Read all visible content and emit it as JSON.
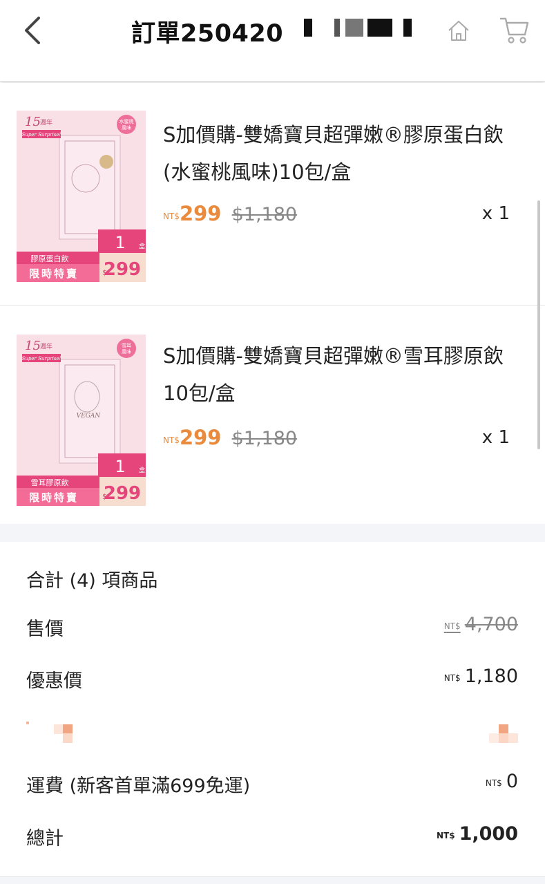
{
  "header": {
    "title": "訂單250420",
    "back_icon": "chevron-left-icon",
    "home_icon": "home-icon",
    "cart_icon": "cart-icon"
  },
  "items": [
    {
      "name": "S加價購-雙嬌寶貝超彈嫩®膠原蛋白飲(水蜜桃風味)10包/盒",
      "currency": "NT$",
      "price": "299",
      "original_price": "$1,180",
      "quantity": "x 1",
      "thumb": {
        "badge_top": "15週年",
        "badge_sub": "Super Surprise!",
        "flavor_tag": "水蜜桃風味",
        "box_count": "1",
        "box_unit": "盒",
        "product_label": "膠原蛋白飲",
        "sale_label": "限時特賣",
        "sale_price": "$299"
      }
    },
    {
      "name": "S加價購-雙嬌寶貝超彈嫩®雪耳膠原飲10包/盒",
      "currency": "NT$",
      "price": "299",
      "original_price": "$1,180",
      "quantity": "x 1",
      "thumb": {
        "badge_top": "15週年",
        "badge_sub": "Super Surprise!",
        "flavor_tag": "雪耳風味",
        "box_count": "1",
        "box_unit": "盒",
        "product_label": "雪耳膠原飲",
        "sale_label": "限時特賣",
        "sale_price": "$299",
        "vegan_label": "VEGAN"
      }
    }
  ],
  "summary": {
    "title": "合計 (4) 項商品",
    "rows": [
      {
        "label": "售價",
        "currency": "NT$",
        "value": "4,700"
      },
      {
        "label": "優惠價",
        "currency": "NT$",
        "value": "1,180"
      },
      {
        "label": "運費 (新客首單滿699免運)",
        "currency": "NT$",
        "value": "0"
      },
      {
        "label": "總計",
        "currency": "NT$",
        "value": "1,000"
      }
    ]
  },
  "colors": {
    "accent_orange": "#e98a3c",
    "pink": "#e5457a",
    "gap_gray": "#f4f5f8"
  }
}
